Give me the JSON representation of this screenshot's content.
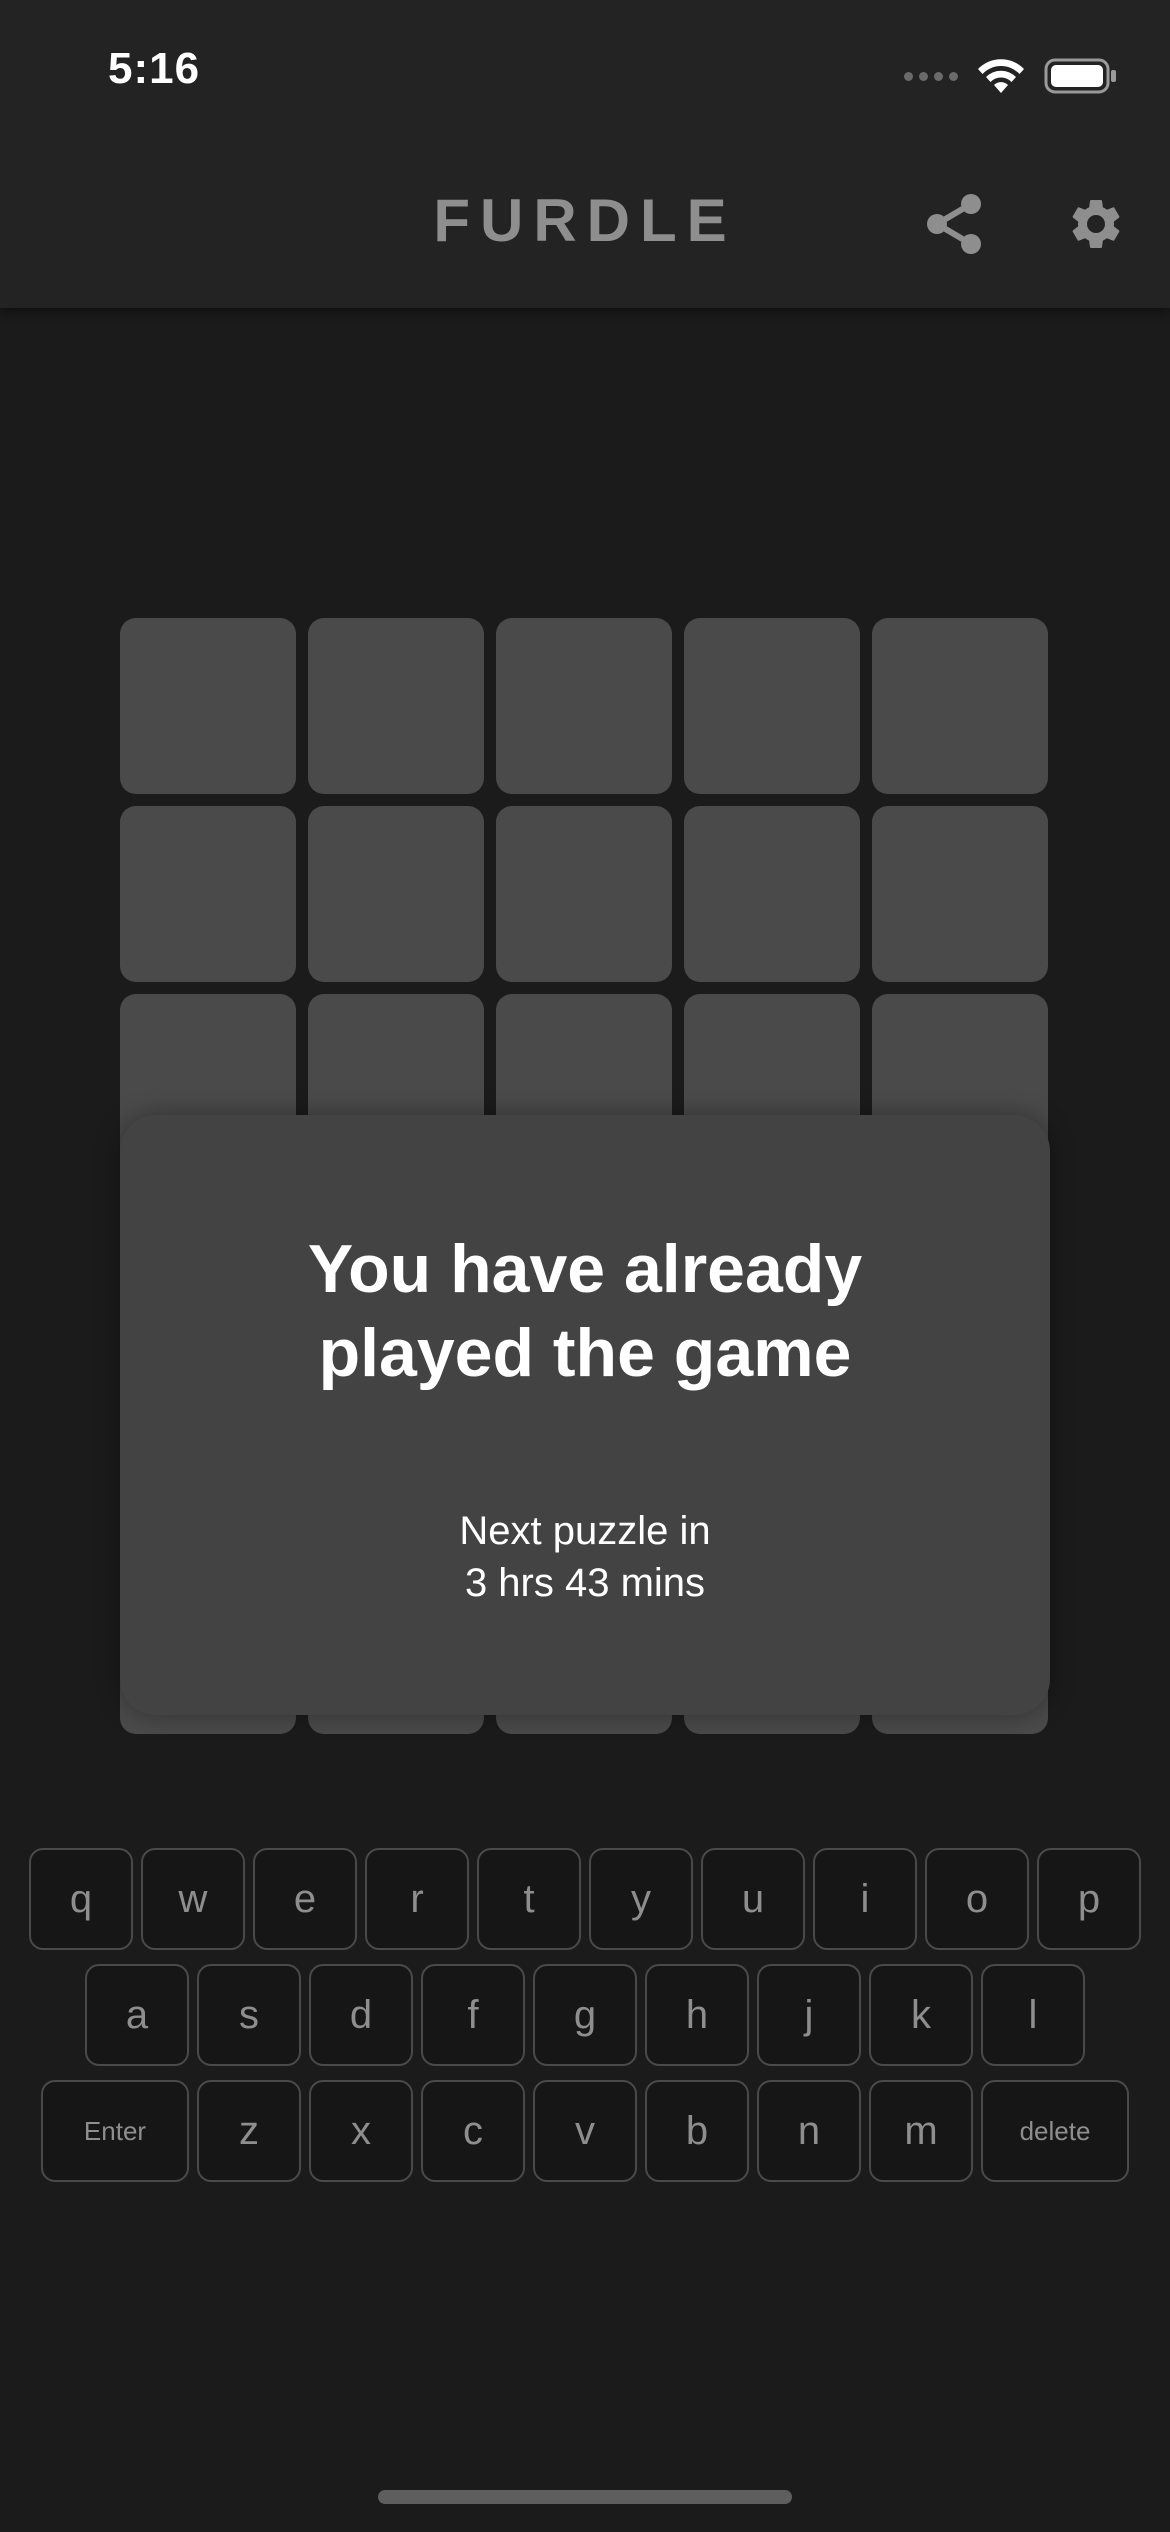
{
  "status_bar": {
    "time": "5:16"
  },
  "header": {
    "title": "FURDLE",
    "share_icon": "share-icon",
    "settings_icon": "gear-icon"
  },
  "grid": {
    "rows_visible": 6,
    "columns": 5
  },
  "modal": {
    "title_line1": "You have already",
    "title_line2": "played the game",
    "sub_line1": "Next puzzle in",
    "sub_line2": "3 hrs 43 mins"
  },
  "keyboard": {
    "row1": [
      "q",
      "w",
      "e",
      "r",
      "t",
      "y",
      "u",
      "i",
      "o",
      "p"
    ],
    "row2": [
      "a",
      "s",
      "d",
      "f",
      "g",
      "h",
      "j",
      "k",
      "l"
    ],
    "row3": [
      "Enter",
      "z",
      "x",
      "c",
      "v",
      "b",
      "n",
      "m",
      "delete"
    ]
  },
  "colors": {
    "background": "#1b1b1b",
    "panel": "#232323",
    "cell": "#4a4a4a",
    "modal": "#434343",
    "title_gray": "#8e8e8e"
  }
}
